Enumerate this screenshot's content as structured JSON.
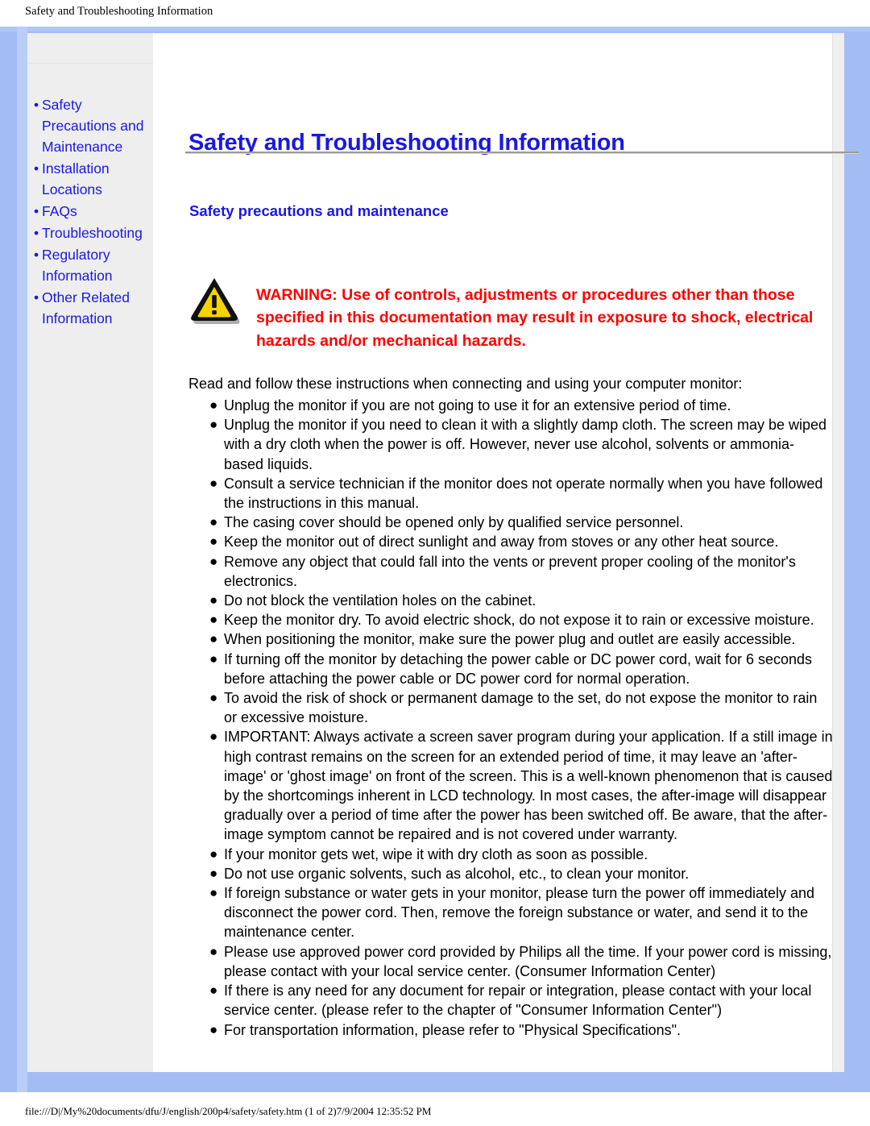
{
  "browser_print": {
    "header_title": "Safety and Troubleshooting Information",
    "footer_path": "file:///D|/My%20documents/dfu/J/english/200p4/safety/safety.htm (1 of 2)7/9/2004 12:35:52 PM"
  },
  "colors": {
    "frame_blue": "#a3bdf4",
    "link_blue": "#1a18e0",
    "warning_red": "#ff0000",
    "sidebar_grey": "#eeeeee",
    "warning_icon_yellow": "#f5d400"
  },
  "sidebar": {
    "items": [
      {
        "bullet": "•",
        "label": "Safety Precautions and Maintenance"
      },
      {
        "bullet": "•",
        "label": "Installation Locations"
      },
      {
        "bullet": "•",
        "label": "FAQs"
      },
      {
        "bullet": "•",
        "label": "Troubleshooting"
      },
      {
        "bullet": "•",
        "label": "Regulatory Information"
      },
      {
        "bullet": "•",
        "label": "Other Related Information"
      }
    ]
  },
  "main": {
    "title": "Safety and Troubleshooting Information",
    "section_title": "Safety precautions and maintenance",
    "warning": {
      "icon": "warning-triangle-icon",
      "text": "WARNING: Use of controls, adjustments or procedures other than those specified in this documentation may result in exposure to shock, electrical hazards and/or mechanical hazards."
    },
    "intro": "Read and follow these instructions when connecting and using your computer monitor:",
    "bullet_glyph": "●",
    "precautions": [
      "Unplug the monitor if you are not going to use it for an extensive period of time.",
      "Unplug the monitor if you need to clean it with a slightly damp cloth. The screen may be wiped with a dry cloth when the power is off. However, never use alcohol, solvents or ammonia-based liquids.",
      "Consult a service technician if the monitor does not operate normally when you have followed the instructions in this manual.",
      "The casing cover should be opened only by qualified service personnel.",
      "Keep the monitor out of direct sunlight and away from stoves or any other heat source.",
      "Remove any object that could fall into the vents or prevent proper cooling of the monitor's electronics.",
      "Do not block the ventilation holes on the cabinet.",
      "Keep the monitor dry. To avoid electric shock, do not expose it to rain or excessive moisture.",
      "When positioning the monitor, make sure the power plug and outlet are easily accessible.",
      "If turning off the monitor by detaching the power cable or DC power cord, wait for 6 seconds before attaching the power cable or DC power cord for normal operation.",
      "To avoid the risk of shock or permanent damage to the set, do not expose the monitor to rain or excessive moisture.",
      "IMPORTANT: Always activate a screen saver program during your application. If a still image in high contrast remains on the screen for an extended period of time, it may leave an 'after-image' or 'ghost image' on front of the screen. This is a well-known phenomenon that is caused by the shortcomings inherent in LCD technology. In most cases, the after-image will disappear gradually over a period of time after the power has been switched off. Be aware, that the after-image symptom cannot be repaired and is not covered under warranty.",
      "If your monitor gets wet, wipe it with dry cloth as soon as possible.",
      "Do not use organic solvents, such as alcohol, etc., to clean your monitor.",
      "If foreign substance or water gets in your monitor, please turn the power off immediately and disconnect the power cord. Then, remove the foreign substance or water, and send it to the maintenance center.",
      "Please use approved power cord provided by Philips all the time. If your power cord is missing, please contact with your local service center. (Consumer Information Center)",
      "If there is any need for any document for repair or integration, please contact with your local service center. (please refer to the chapter of \"Consumer Information Center\")",
      "For transportation information, please refer to \"Physical Specifications\"."
    ]
  }
}
